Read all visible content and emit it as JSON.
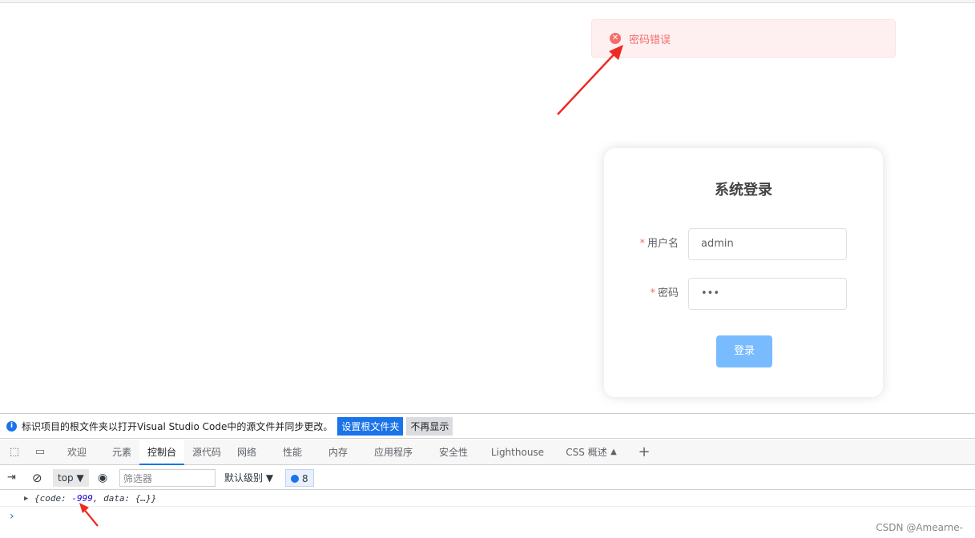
{
  "toast": {
    "message": "密码错误",
    "icon": "error-circle-icon",
    "color": "#f56c6c"
  },
  "login": {
    "title": "系统登录",
    "fields": [
      {
        "label": "用户名",
        "required_mark": "*",
        "value": "admin"
      },
      {
        "label": "密码",
        "required_mark": "*",
        "value": "•••"
      }
    ],
    "submit_label": "登录"
  },
  "devtools": {
    "infobar": {
      "message": "标识项目的根文件夹以打开Visual Studio Code中的源文件并同步更改。",
      "primary_button": "设置根文件夹",
      "secondary_button": "不再显示"
    },
    "tabs": [
      "欢迎",
      "元素",
      "控制台",
      "源代码",
      "网络",
      "性能",
      "内存",
      "应用程序",
      "安全性",
      "Lighthouse",
      "CSS 概述"
    ],
    "active_tab": "控制台",
    "toolbar": {
      "context": "top",
      "filter_placeholder": "筛选器",
      "level": "默认级别",
      "message_count": "8"
    },
    "console": {
      "log_prefix": "{code: ",
      "log_code": "-999",
      "log_suffix": ", data: {…}}"
    }
  },
  "watermark": "CSDN @Amearne-"
}
